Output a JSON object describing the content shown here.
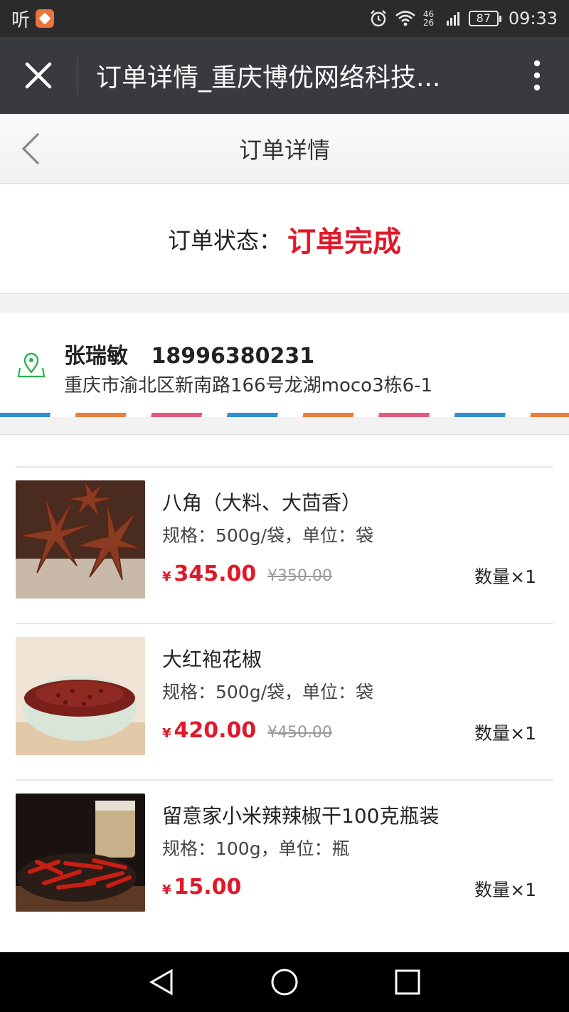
{
  "status_bar": {
    "app_text": "听",
    "alarm_icon": "alarm-icon",
    "network_text": "46 26",
    "battery": "87",
    "time": "09:33"
  },
  "browser": {
    "title": "订单详情_重庆博优网络科技...",
    "close_icon": "close-icon",
    "more_icon": "more-vertical-icon"
  },
  "header": {
    "title": "订单详情",
    "back_icon": "chevron-left-icon"
  },
  "order_status": {
    "label": "订单状态：",
    "value": "订单完成",
    "value_color": "#e0192a"
  },
  "address": {
    "icon": "location-pin-icon",
    "name": "张瑞敏",
    "phone": "18996380231",
    "detail": "重庆市渝北区新南路166号龙湖moco3栋6-1"
  },
  "products": [
    {
      "name": "八角（大料、大茴香）",
      "spec": "规格：500g/袋，单位：袋",
      "currency": "¥",
      "price": "345.00",
      "original_price": "¥350.00",
      "quantity": "数量×1",
      "image": "star-anise-photo"
    },
    {
      "name": "大红袍花椒",
      "spec": "规格：500g/袋，单位：袋",
      "currency": "¥",
      "price": "420.00",
      "original_price": "¥450.00",
      "quantity": "数量×1",
      "image": "sichuan-pepper-bowl-photo"
    },
    {
      "name": "留意家小米辣辣椒干100克瓶装",
      "spec": "规格：100g，单位：瓶",
      "currency": "¥",
      "price": "15.00",
      "original_price": "",
      "quantity": "数量×1",
      "image": "dried-chili-photo"
    }
  ],
  "nav": {
    "back": "triangle-back-icon",
    "home": "circle-home-icon",
    "recent": "square-recent-icon"
  }
}
